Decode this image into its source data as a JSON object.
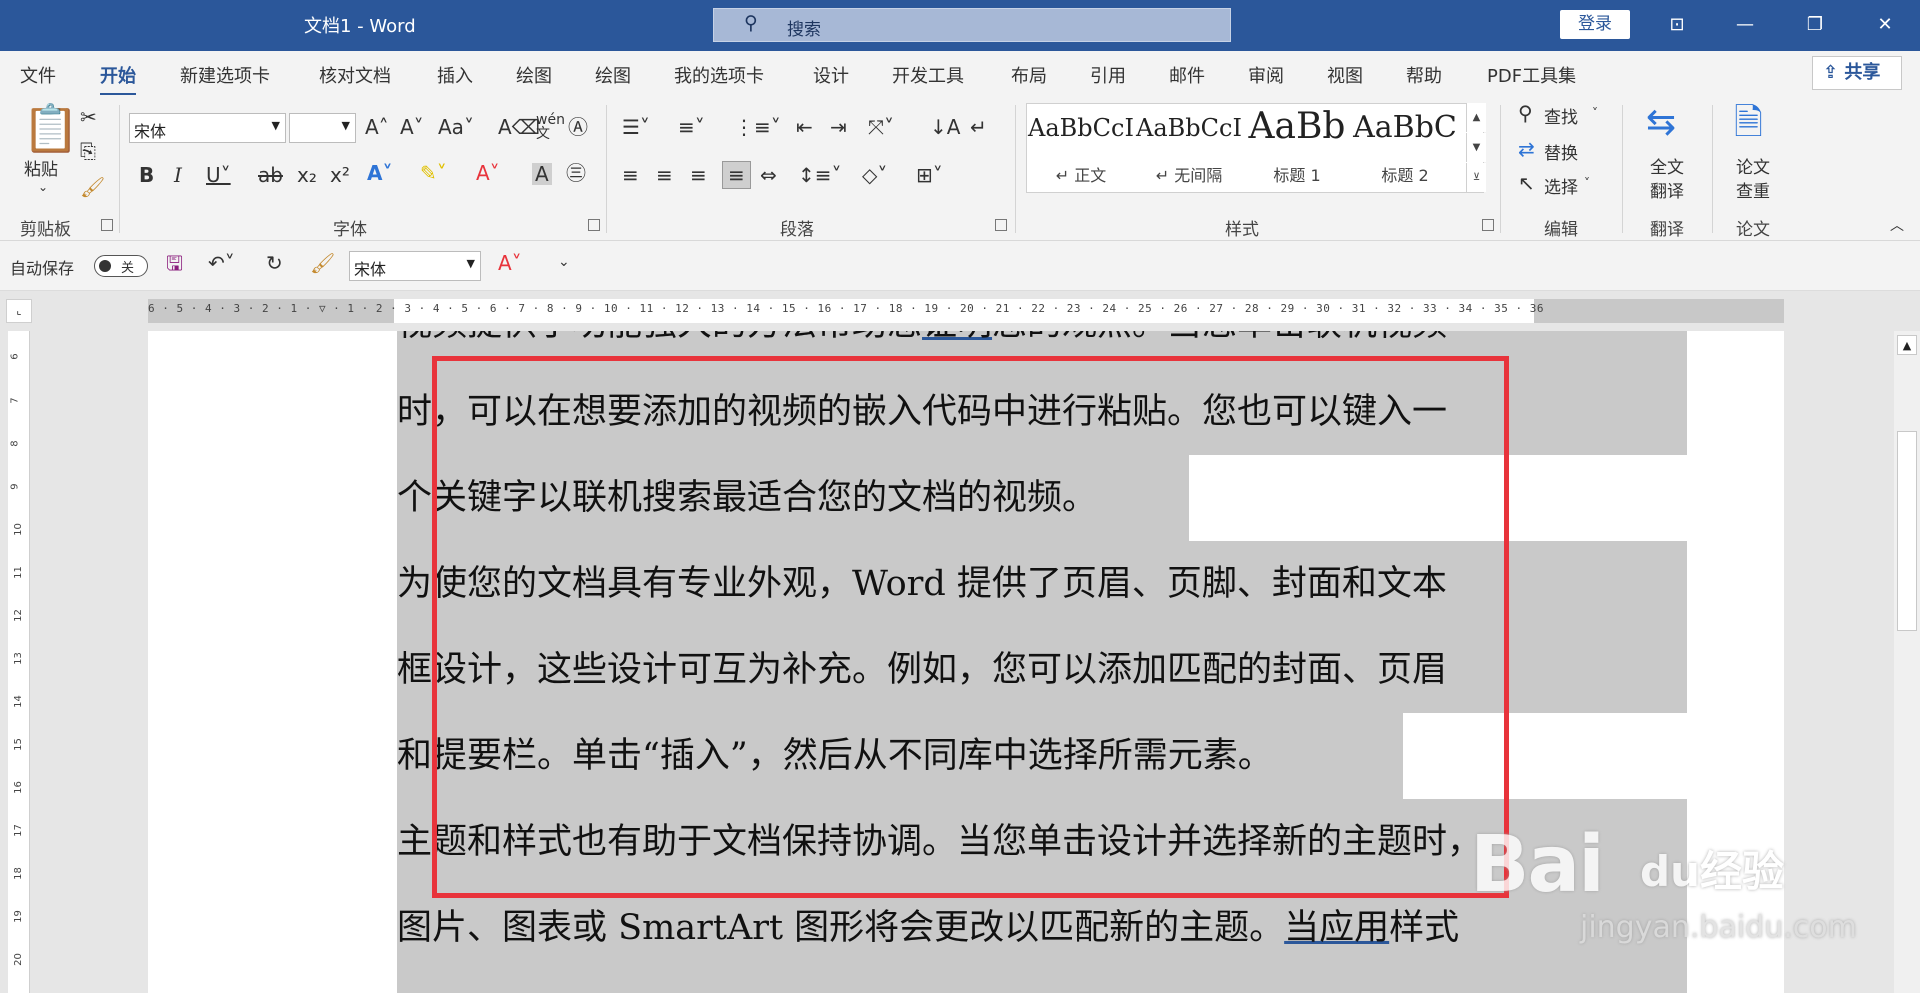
{
  "app": {
    "doc_title": "文档1  -  Word",
    "search_placeholder": "搜索",
    "login_label": "登录",
    "share_label": "共享"
  },
  "tabs": [
    "文件",
    "开始",
    "新建选项卡",
    "核对文档",
    "插入",
    "绘图",
    "绘图",
    "我的选项卡",
    "设计",
    "开发工具",
    "布局",
    "引用",
    "邮件",
    "审阅",
    "视图",
    "帮助",
    "PDF工具集"
  ],
  "active_tab": "开始",
  "ribbon": {
    "clipboard": {
      "paste_label": "粘贴",
      "group_label": "剪贴板"
    },
    "font": {
      "font_name": "宋体",
      "font_size": "",
      "group_label": "字体",
      "case_label": "Aa"
    },
    "paragraph": {
      "group_label": "段落"
    },
    "styles": {
      "group_label": "样式",
      "items": [
        {
          "sample": "AaBbCcI",
          "name": "↵ 正文"
        },
        {
          "sample": "AaBbCcI",
          "name": "↵ 无间隔"
        },
        {
          "sample": "AaBb",
          "name": "标题 1"
        },
        {
          "sample": "AaBbC",
          "name": "标题 2"
        }
      ]
    },
    "editing": {
      "find": "查找",
      "replace": "替换",
      "select": "选择",
      "group_label": "编辑"
    },
    "translate": {
      "label_line1": "全文",
      "label_line2": "翻译",
      "group_label": "翻译"
    },
    "paper": {
      "label_line1": "论文",
      "label_line2": "查重",
      "group_label": "论文"
    }
  },
  "qat": {
    "autosave_label": "自动保存",
    "autosave_state": "关",
    "font_name": "宋体"
  },
  "ruler": {
    "h_numbers": "6 · 5 · 4 · 3 · 2 · 1 · ▽ · 1 · 2 · 3 · 4 · 5 · 6 · 7 · 8 · 9 · 10 · 11 · 12 · 13 · 14 · 15 · 16 · 17 · 18 · 19 · 20 · 21 · 22 · 23 · 24 · 25 · 26 · 27 · 28 · 29 · 30 · 31 · 32 · 33 · 34 · 35 · 36",
    "v_numbers": [
      "6",
      "7",
      "8",
      "9",
      "10",
      "11",
      "12",
      "13",
      "14",
      "15",
      "16",
      "17",
      "18",
      "19",
      "20"
    ]
  },
  "document": {
    "lines": [
      {
        "pre": "视频提供了功能强大的方法帮助您",
        "ul": "证明",
        "post": "您的观点。当您单击联机视频"
      },
      {
        "pre": "时，可以在想要添加的视频的嵌入代码中进行粘贴。您也可以键入一",
        "ul": "",
        "post": ""
      },
      {
        "pre": "个关键字以联机搜索最适合您的文档的视频。",
        "ul": "",
        "post": ""
      },
      {
        "pre": "为使您的文档具有专业外观，Word 提供了页眉、页脚、封面和文本",
        "ul": "",
        "post": ""
      },
      {
        "pre": "框设计，这些设计可互为补充。例如，您可以添加匹配的封面、页眉",
        "ul": "",
        "post": ""
      },
      {
        "pre": "和提要栏。单击“插入”，然后从不同库中选择所需元素。",
        "ul": "",
        "post": ""
      },
      {
        "pre": "主题和样式也有助于文档保持协调。当您单击设计并选择新的主题时，",
        "ul": "",
        "post": ""
      },
      {
        "pre": "图片、图表或 SmartArt 图形将会更改以匹配新的主题。",
        "ul": "当应用",
        "post": "样式"
      }
    ]
  },
  "watermark": {
    "brand": "Bai",
    "brand2": "du经验",
    "url": "jingyan.baidu.com"
  }
}
